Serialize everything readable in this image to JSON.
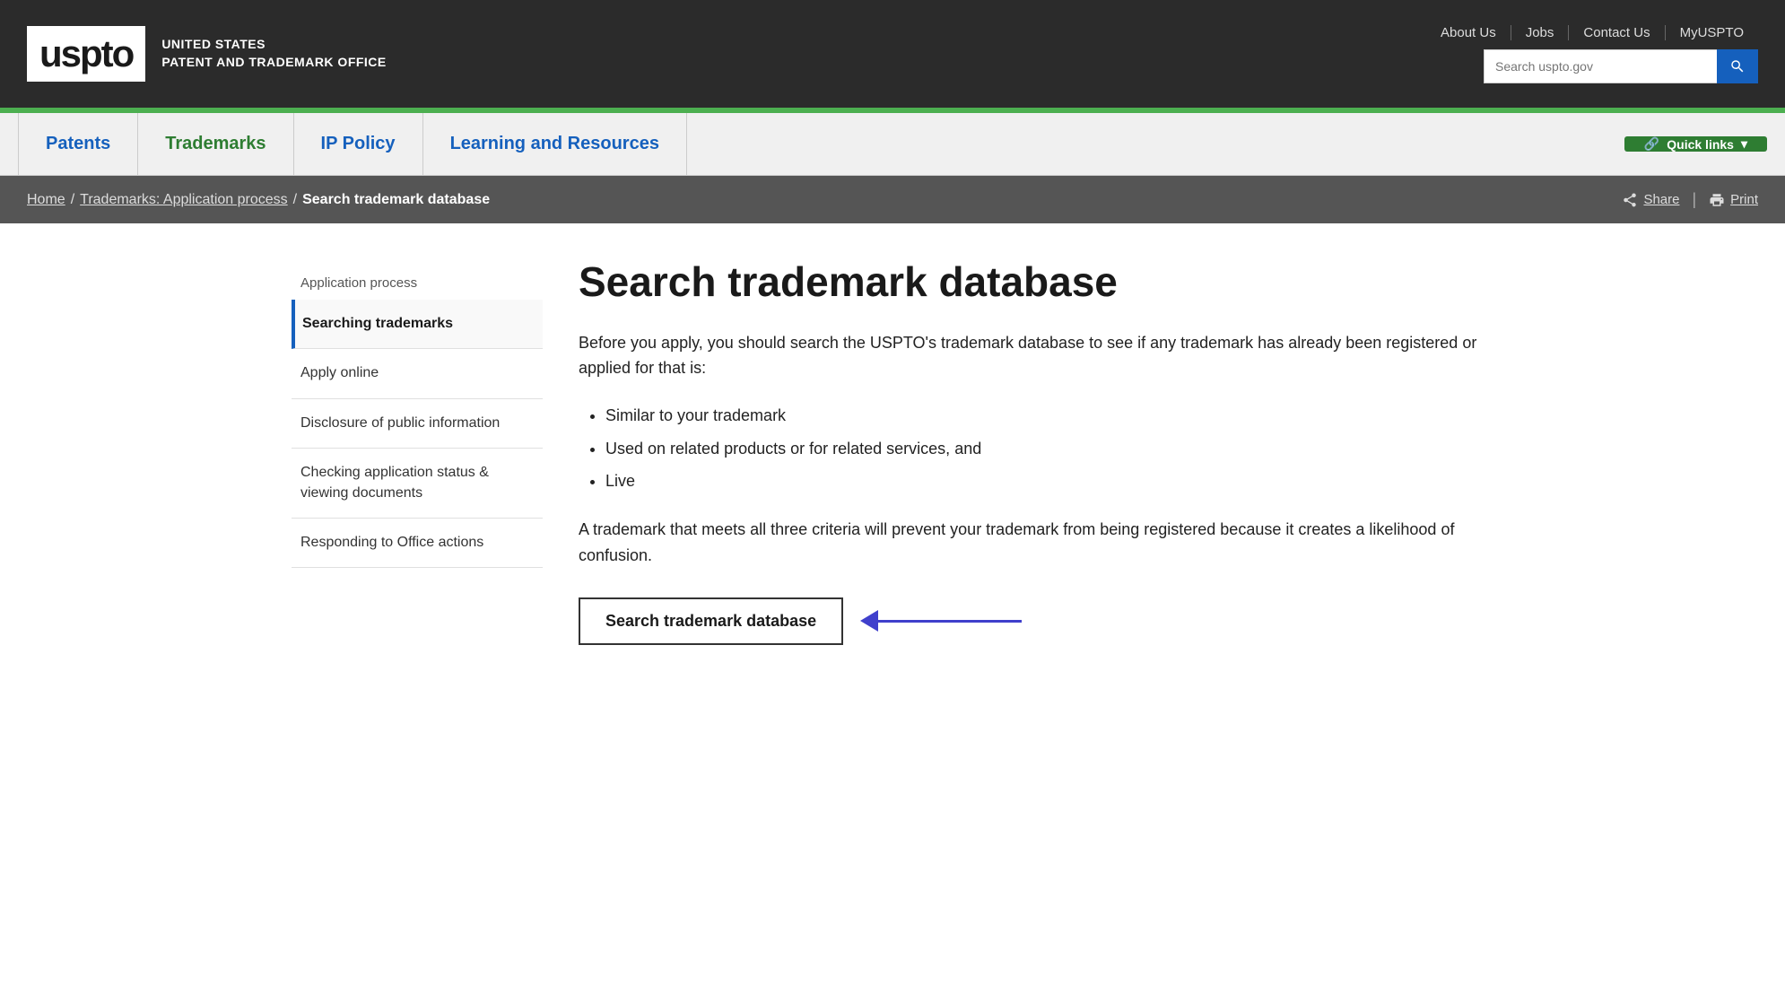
{
  "topbar": {
    "logo_text": "uspto",
    "logo_subtext_line1": "UNITED STATES",
    "logo_subtext_line2": "PATENT AND TRADEMARK OFFICE",
    "links": [
      "About Us",
      "Jobs",
      "Contact Us",
      "MyUSPTO"
    ],
    "search_placeholder": "Search uspto.gov"
  },
  "accent_bar": {},
  "main_nav": {
    "items": [
      {
        "label": "Patents",
        "active": false
      },
      {
        "label": "Trademarks",
        "active": true
      },
      {
        "label": "IP Policy",
        "active": false
      },
      {
        "label": "Learning and Resources",
        "active": false
      }
    ],
    "quick_links_label": "Quick links"
  },
  "breadcrumb": {
    "home": "Home",
    "section": "Trademarks: Application process",
    "current": "Search trademark database",
    "share_label": "Share",
    "print_label": "Print"
  },
  "sidebar": {
    "parent_label": "Application process",
    "items": [
      {
        "label": "Searching trademarks",
        "active": true
      },
      {
        "label": "Apply online",
        "active": false
      },
      {
        "label": "Disclosure of public information",
        "active": false
      },
      {
        "label": "Checking application status & viewing documents",
        "active": false
      },
      {
        "label": "Responding to Office actions",
        "active": false
      }
    ]
  },
  "main": {
    "title": "Search trademark database",
    "intro": "Before you apply, you should search the USPTO's trademark database to see if any trademark has already been registered or applied for that is:",
    "bullets": [
      "Similar to your trademark",
      "Used on related products or for related services, and",
      "Live"
    ],
    "criteria_text": "A trademark that meets all three criteria will prevent your trademark from being registered because it creates a likelihood of confusion.",
    "cta_button_label": "Search trademark database"
  }
}
